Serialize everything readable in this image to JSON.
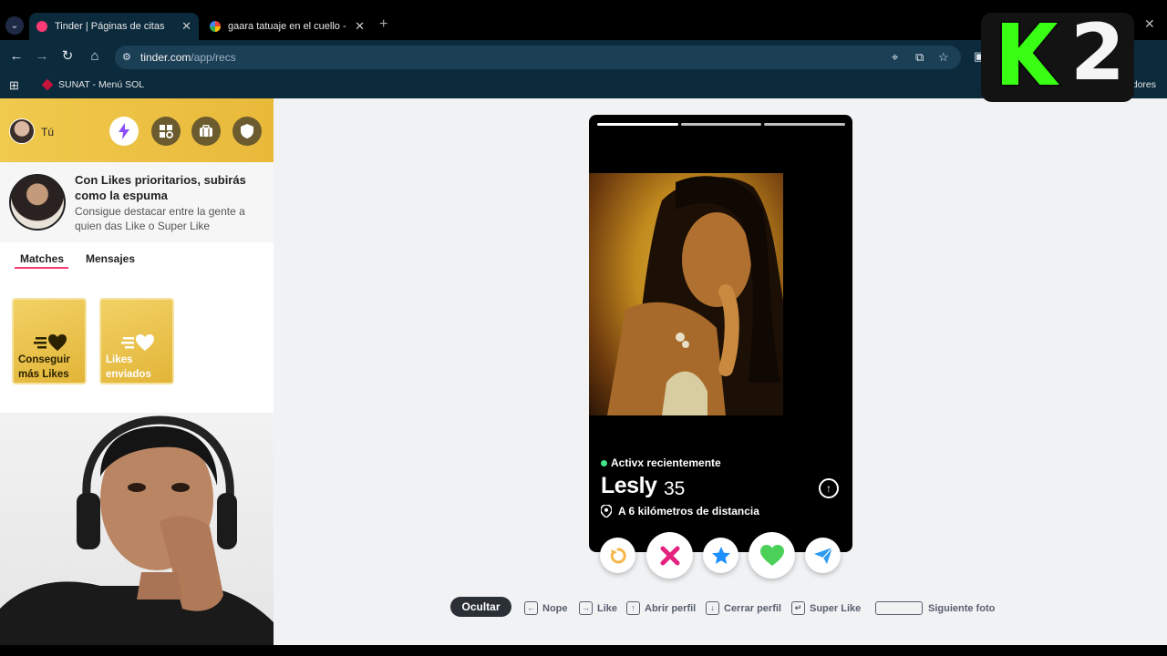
{
  "browser": {
    "tabs": [
      {
        "title": "Tinder | Páginas de citas",
        "active": true,
        "favicon_color": "#fd3a73"
      },
      {
        "title": "gaara tatuaje en el cuello - Busc",
        "active": false,
        "favicon_color": "#4285f4"
      }
    ],
    "url_host": "tinder.com",
    "url_path": "/app/recs",
    "bookmarks": [
      {
        "label": "SUNAT - Menú SOL"
      }
    ],
    "all_bookmarks_label": "Todos los marcadores"
  },
  "overlay_logo": {
    "letter": "K",
    "digit": "2",
    "accent": "#39ff14"
  },
  "sidebar": {
    "user_label": "Tú",
    "header_icons": [
      {
        "icon": "boost-bolt-icon",
        "color": "#8a4dff"
      },
      {
        "icon": "explore-icon",
        "color": "#6b5b2e"
      },
      {
        "icon": "passport-icon",
        "color": "#6b5b2e"
      },
      {
        "icon": "shield-icon",
        "color": "#6b5b2e"
      }
    ],
    "promo": {
      "title": "Con Likes prioritarios, subirás como la espuma",
      "subtitle": "Consigue destacar entre la gente a quien das Like o Super Like"
    },
    "tabs": [
      {
        "label": "Matches",
        "active": true
      },
      {
        "label": "Mensajes",
        "active": false
      }
    ],
    "cards": [
      {
        "label_line1": "Conseguir",
        "label_line2": "más Likes",
        "text_color": "#2a2200"
      },
      {
        "label_line1": "Likes",
        "label_line2": "enviados",
        "text_color": "#ffffff"
      }
    ]
  },
  "profile": {
    "photo_count": 3,
    "photo_index": 1,
    "status": "Activx recientemente",
    "name": "Lesly",
    "age": "35",
    "distance": "A 6 kilómetros de distancia"
  },
  "actions": [
    {
      "name": "rewind",
      "icon": "rewind-icon",
      "color": "#f5b748"
    },
    {
      "name": "nope",
      "icon": "nope-x-icon",
      "color": "#e4237f"
    },
    {
      "name": "super-like",
      "icon": "star-icon",
      "color": "#1e8fff"
    },
    {
      "name": "like",
      "icon": "heart-icon",
      "color": "#4bd15a"
    },
    {
      "name": "boost",
      "icon": "send-icon",
      "color": "#2c9bf0"
    }
  ],
  "shortcuts": {
    "hide_label": "Ocultar",
    "items": [
      {
        "key": "←",
        "label": "Nope"
      },
      {
        "key": "→",
        "label": "Like"
      },
      {
        "key": "↑",
        "label": "Abrir perfil"
      },
      {
        "key": "↓",
        "label": "Cerrar perfil"
      },
      {
        "key": "↵",
        "label": "Super Like"
      },
      {
        "key": "space",
        "label": "Siguiente foto"
      }
    ]
  },
  "colors": {
    "tinder_pink": "#fd3a73",
    "gold": "#e9b93a",
    "chrome_dark": "#0b2a3c"
  }
}
